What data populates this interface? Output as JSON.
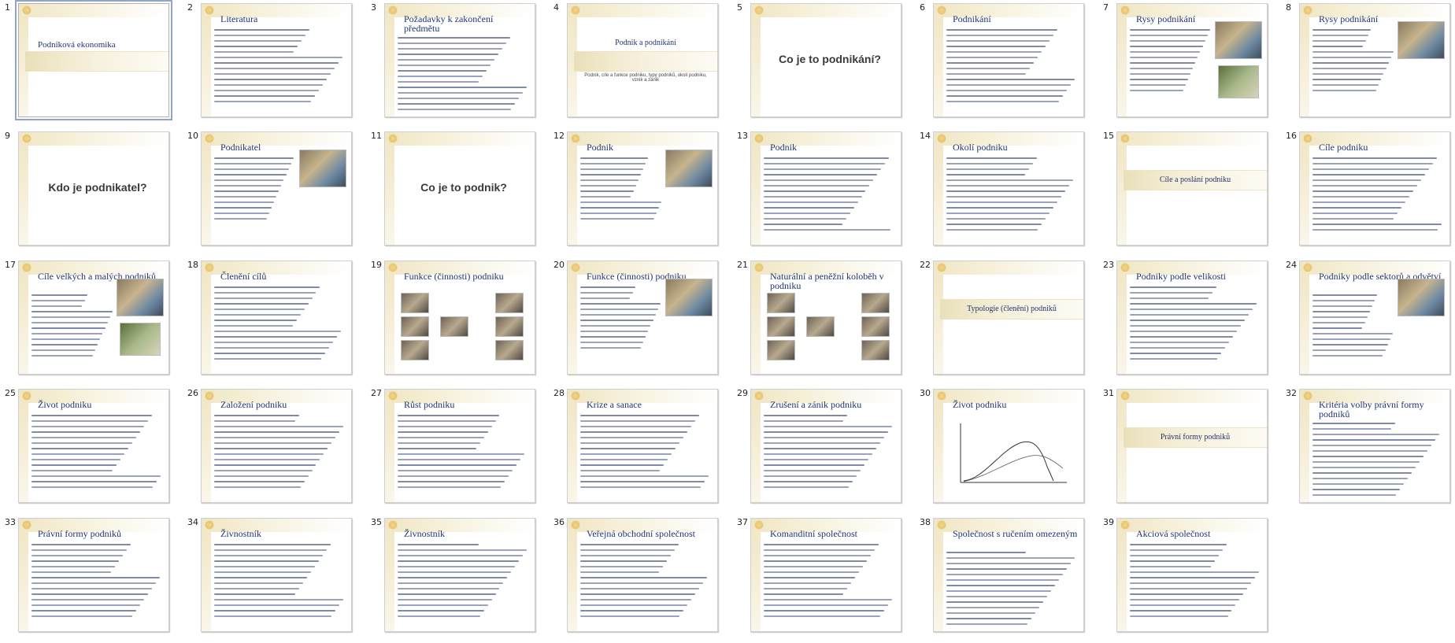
{
  "app": {
    "name": "Slide sorter"
  },
  "slides": [
    {
      "n": "1",
      "title": "Podniková ekonomika",
      "layout": "title",
      "selected": true
    },
    {
      "n": "2",
      "title": "Literatura",
      "layout": "text"
    },
    {
      "n": "3",
      "title": "Požadavky k zakončení předmětu",
      "layout": "text"
    },
    {
      "n": "4",
      "title": "Podnik a podnikání",
      "subtitle": "Podnik, cíle a funkce podniku, typy podniků, okolí podniku, vznik a zánik",
      "layout": "title2"
    },
    {
      "n": "5",
      "title": "Co je to podnikání?",
      "layout": "question"
    },
    {
      "n": "6",
      "title": "Podnikání",
      "layout": "text"
    },
    {
      "n": "7",
      "title": "Rysy podnikání",
      "layout": "textpic"
    },
    {
      "n": "8",
      "title": "Rysy podnikání",
      "layout": "textpic"
    },
    {
      "n": "9",
      "title": "Kdo je podnikatel?",
      "layout": "question"
    },
    {
      "n": "10",
      "title": "Podnikatel",
      "layout": "textpic"
    },
    {
      "n": "11",
      "title": "Co je to podnik?",
      "layout": "question"
    },
    {
      "n": "12",
      "title": "Podnik",
      "layout": "textpic"
    },
    {
      "n": "13",
      "title": "Podnik",
      "layout": "text"
    },
    {
      "n": "14",
      "title": "Okolí podniku",
      "layout": "text"
    },
    {
      "n": "15",
      "title": "Cíle a poslání podniku",
      "layout": "section"
    },
    {
      "n": "16",
      "title": "Cíle podniku",
      "layout": "text"
    },
    {
      "n": "17",
      "title": "Cíle velkých a malých podniků",
      "layout": "textpic"
    },
    {
      "n": "18",
      "title": "Členění cílů",
      "layout": "text"
    },
    {
      "n": "19",
      "title": "Funkce (činnosti) podniku",
      "layout": "diagram"
    },
    {
      "n": "20",
      "title": "Funkce (činnosti) podniku",
      "layout": "textpic"
    },
    {
      "n": "21",
      "title": "Naturální a peněžní koloběh v podniku",
      "layout": "diagram"
    },
    {
      "n": "22",
      "title": "Typologie (členění) podniků",
      "layout": "section"
    },
    {
      "n": "23",
      "title": "Podniky podle velikosti",
      "layout": "text"
    },
    {
      "n": "24",
      "title": "Podniky podle sektorů a odvětví",
      "layout": "textpic"
    },
    {
      "n": "25",
      "title": "Život podniku",
      "layout": "text"
    },
    {
      "n": "26",
      "title": "Založení podniku",
      "layout": "text"
    },
    {
      "n": "27",
      "title": "Růst podniku",
      "layout": "text"
    },
    {
      "n": "28",
      "title": "Krize a sanace",
      "layout": "text"
    },
    {
      "n": "29",
      "title": "Zrušení a zánik podniku",
      "layout": "text"
    },
    {
      "n": "30",
      "title": "Život podniku",
      "layout": "chart"
    },
    {
      "n": "31",
      "title": "Právní formy podniků",
      "layout": "section"
    },
    {
      "n": "32",
      "title": "Kritéria volby právní formy podniků",
      "layout": "text"
    },
    {
      "n": "33",
      "title": "Právní formy podniků",
      "layout": "text"
    },
    {
      "n": "34",
      "title": "Živnostník",
      "layout": "text"
    },
    {
      "n": "35",
      "title": "Živnostník",
      "layout": "text"
    },
    {
      "n": "36",
      "title": "Veřejná obchodní společnost",
      "layout": "text"
    },
    {
      "n": "37",
      "title": "Komanditní společnost",
      "layout": "text"
    },
    {
      "n": "38",
      "title": "Společnost s ručením omezeným",
      "layout": "text"
    },
    {
      "n": "39",
      "title": "Akciová společnost",
      "layout": "text"
    }
  ],
  "colors": {
    "title": "#1f3570",
    "bullet": "#c24a3a",
    "selection": "#8fa6c9"
  }
}
